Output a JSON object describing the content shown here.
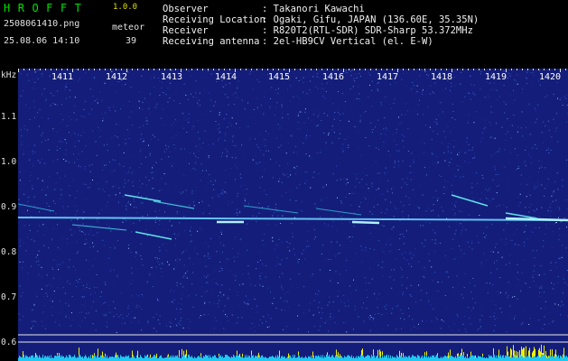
{
  "header": {
    "logo": "HROFFT",
    "version": "1.0.0",
    "filename": "2508061410.png",
    "meteor_label": "meteor",
    "datetime": "25.08.06 14:10",
    "meteor_count": "39",
    "info": [
      {
        "label": "Observer",
        "value": ": Takanori Kawachi"
      },
      {
        "label": "Receiving Location",
        "value": ": Ogaki, Gifu, JAPAN (136.60E, 35.35N)"
      },
      {
        "label": "Receiver",
        "value": ": R820T2(RTL-SDR) SDR-Sharp 53.372MHz"
      },
      {
        "label": "Receiving antenna",
        "value": ": 2el-HB9CV Vertical (el. E-W)"
      }
    ]
  },
  "axes": {
    "y_unit": "kHz",
    "y_ticks": [
      "1.1",
      "1.0",
      "0.9",
      "0.8",
      "0.7",
      "0.6"
    ],
    "x_ticks": [
      "1411",
      "1412",
      "1413",
      "1414",
      "1415",
      "1416",
      "1417",
      "1418",
      "1419",
      "1420"
    ]
  },
  "colors": {
    "background": "#141e7a",
    "carrier": "#7fdcff",
    "meteor": "#5fe0e8",
    "histogram_cyan": "#1ec8f0",
    "histogram_yellow": "#f0f000"
  }
}
